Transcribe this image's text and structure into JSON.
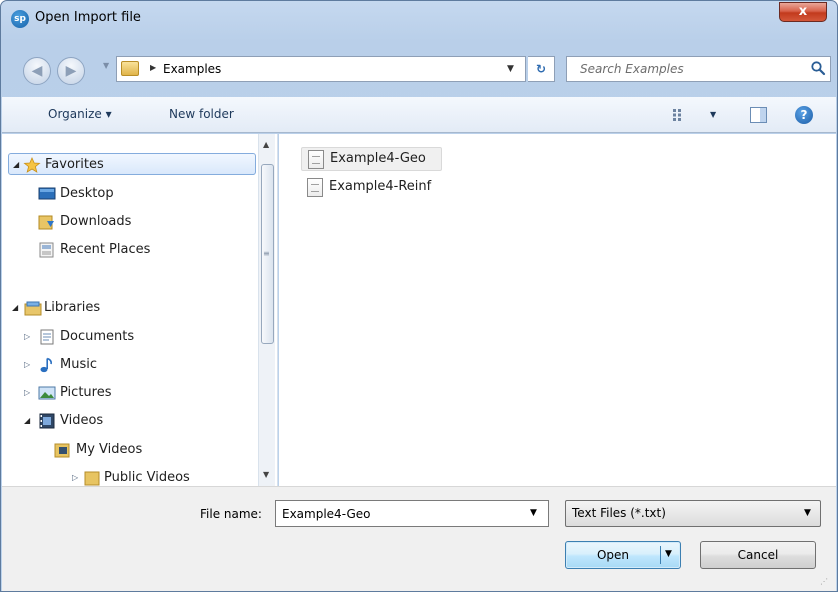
{
  "window": {
    "title": "Open Import file",
    "app_icon_text": "sp",
    "close_glyph": "x"
  },
  "navigation": {
    "back_icon": "back-arrow-icon",
    "forward_icon": "forward-arrow-icon",
    "address_path": "Examples",
    "search_placeholder": "Search Examples"
  },
  "toolbar": {
    "organize_label": "Organize ▾",
    "new_folder_label": "New folder"
  },
  "tree": {
    "items": [
      {
        "label": "Favorites",
        "icon": "star-icon",
        "expander": "◢",
        "selected": true
      },
      {
        "label": "Desktop",
        "icon": "desktop-icon"
      },
      {
        "label": "Downloads",
        "icon": "downloads-folder-icon"
      },
      {
        "label": "Recent Places",
        "icon": "recent-places-icon"
      },
      {
        "label": "Libraries",
        "icon": "libraries-icon",
        "expander": "◢"
      },
      {
        "label": "Documents",
        "icon": "documents-icon",
        "expander": "▷"
      },
      {
        "label": "Music",
        "icon": "music-icon",
        "expander": "▷"
      },
      {
        "label": "Pictures",
        "icon": "pictures-icon",
        "expander": "▷"
      },
      {
        "label": "Videos",
        "icon": "videos-icon",
        "expander": "◢"
      },
      {
        "label": "My Videos",
        "icon": "video-folder-icon"
      },
      {
        "label": "Public Videos",
        "icon": "folder-icon",
        "expander": "▷"
      }
    ]
  },
  "files": [
    {
      "name": "Example4-Geo",
      "selected": true
    },
    {
      "name": "Example4-Reinf",
      "selected": false
    }
  ],
  "footer": {
    "file_name_label": "File name:",
    "file_name_value": "Example4-Geo",
    "file_type": "Text Files (*.txt)",
    "open_label": "Open",
    "cancel_label": "Cancel"
  },
  "colors": {
    "frame": "#bcd3ec",
    "selection_border": "#84acdd",
    "close_red": "#c23a1d"
  }
}
